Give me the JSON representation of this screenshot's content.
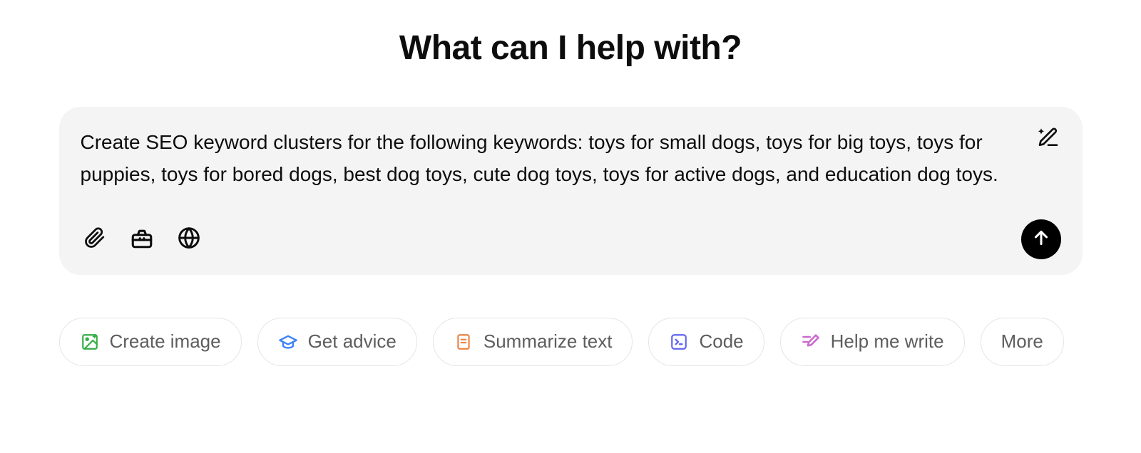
{
  "heading": "What can I help with?",
  "prompt": {
    "text": "Create SEO keyword clusters for the following keywords: toys for small dogs, toys for big toys, toys for puppies, toys for bored dogs, best dog toys, cute dog toys, toys for active dogs, and education dog toys."
  },
  "icons": {
    "magic_edit": "magic-pencil",
    "attachment": "paperclip",
    "tools": "toolbox",
    "web": "globe",
    "send": "arrow-up"
  },
  "suggestions": [
    {
      "icon": "image",
      "label": "Create image",
      "color": "#35ae47"
    },
    {
      "icon": "graduation-cap",
      "label": "Get advice",
      "color": "#3b82f6"
    },
    {
      "icon": "document",
      "label": "Summarize text",
      "color": "#ea8444"
    },
    {
      "icon": "code",
      "label": "Code",
      "color": "#6366f1"
    },
    {
      "icon": "write",
      "label": "Help me write",
      "color": "#cb6ad0"
    }
  ],
  "more_label": "More"
}
